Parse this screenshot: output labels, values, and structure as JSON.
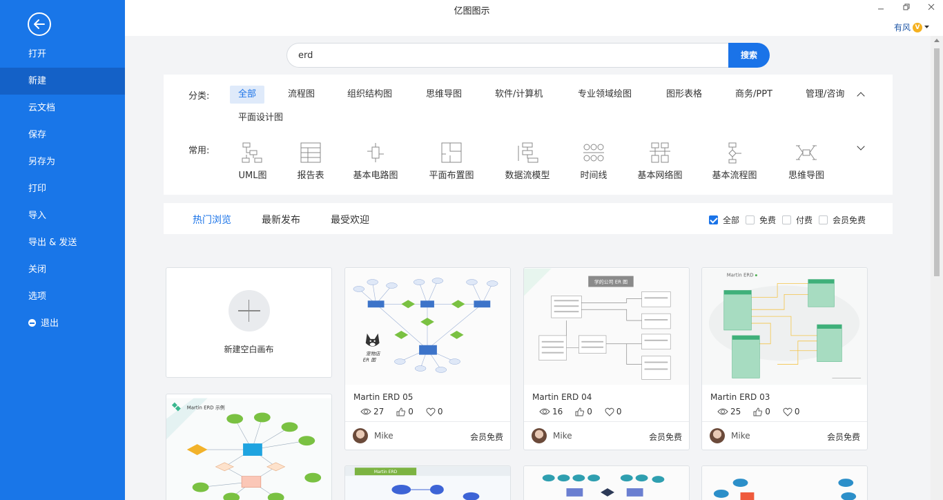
{
  "app": {
    "title": "亿图图示",
    "user": "有风"
  },
  "sidebar": {
    "items": [
      {
        "label": "打开"
      },
      {
        "label": "新建"
      },
      {
        "label": "云文档"
      },
      {
        "label": "保存"
      },
      {
        "label": "另存为"
      },
      {
        "label": "打印"
      },
      {
        "label": "导入"
      },
      {
        "label": "导出 & 发送"
      },
      {
        "label": "关闭"
      },
      {
        "label": "选项"
      },
      {
        "label": "退出"
      }
    ]
  },
  "search": {
    "value": "erd",
    "button": "搜索"
  },
  "categories": {
    "label": "分类:",
    "items": [
      "全部",
      "流程图",
      "组织结构图",
      "思维导图",
      "软件/计算机",
      "专业领域绘图",
      "图形表格",
      "商务/PPT",
      "管理/咨询",
      "平面设计图"
    ]
  },
  "common": {
    "label": "常用:",
    "items": [
      "UML图",
      "报告表",
      "基本电路图",
      "平面布置图",
      "数据流模型",
      "时间线",
      "基本网络图",
      "基本流程图",
      "思维导图"
    ]
  },
  "tabs": [
    "热门浏览",
    "最新发布",
    "最受欢迎"
  ],
  "filters": [
    {
      "label": "全部",
      "checked": true
    },
    {
      "label": "免费",
      "checked": false
    },
    {
      "label": "付费",
      "checked": false
    },
    {
      "label": "会员免费",
      "checked": false
    }
  ],
  "blank_card": {
    "label": "新建空白画布"
  },
  "cards": [
    {
      "title": "Martin ERD 05",
      "views": "27",
      "likes": "0",
      "favs": "0",
      "author": "Mike",
      "price": "会员免费"
    },
    {
      "title": "Martin ERD 04",
      "views": "16",
      "likes": "0",
      "favs": "0",
      "author": "Mike",
      "price": "会员免费"
    },
    {
      "title": "Martin ERD 03",
      "views": "25",
      "likes": "0",
      "favs": "0",
      "author": "Mike",
      "price": "会员免费"
    }
  ],
  "thumb_texts": {
    "card_erd05_caption": "宠物店\nER 图",
    "card_erd04_header": "学的公司 ER 图",
    "card_erd03_header": "Martin ERD",
    "lower_left_header": "Martin ERD 示例",
    "lower_mid_header": "Martin ERD"
  },
  "colors": {
    "accent": "#1a73e8",
    "sidebar": "#1976e8",
    "sidebar_active": "#1461c7"
  }
}
